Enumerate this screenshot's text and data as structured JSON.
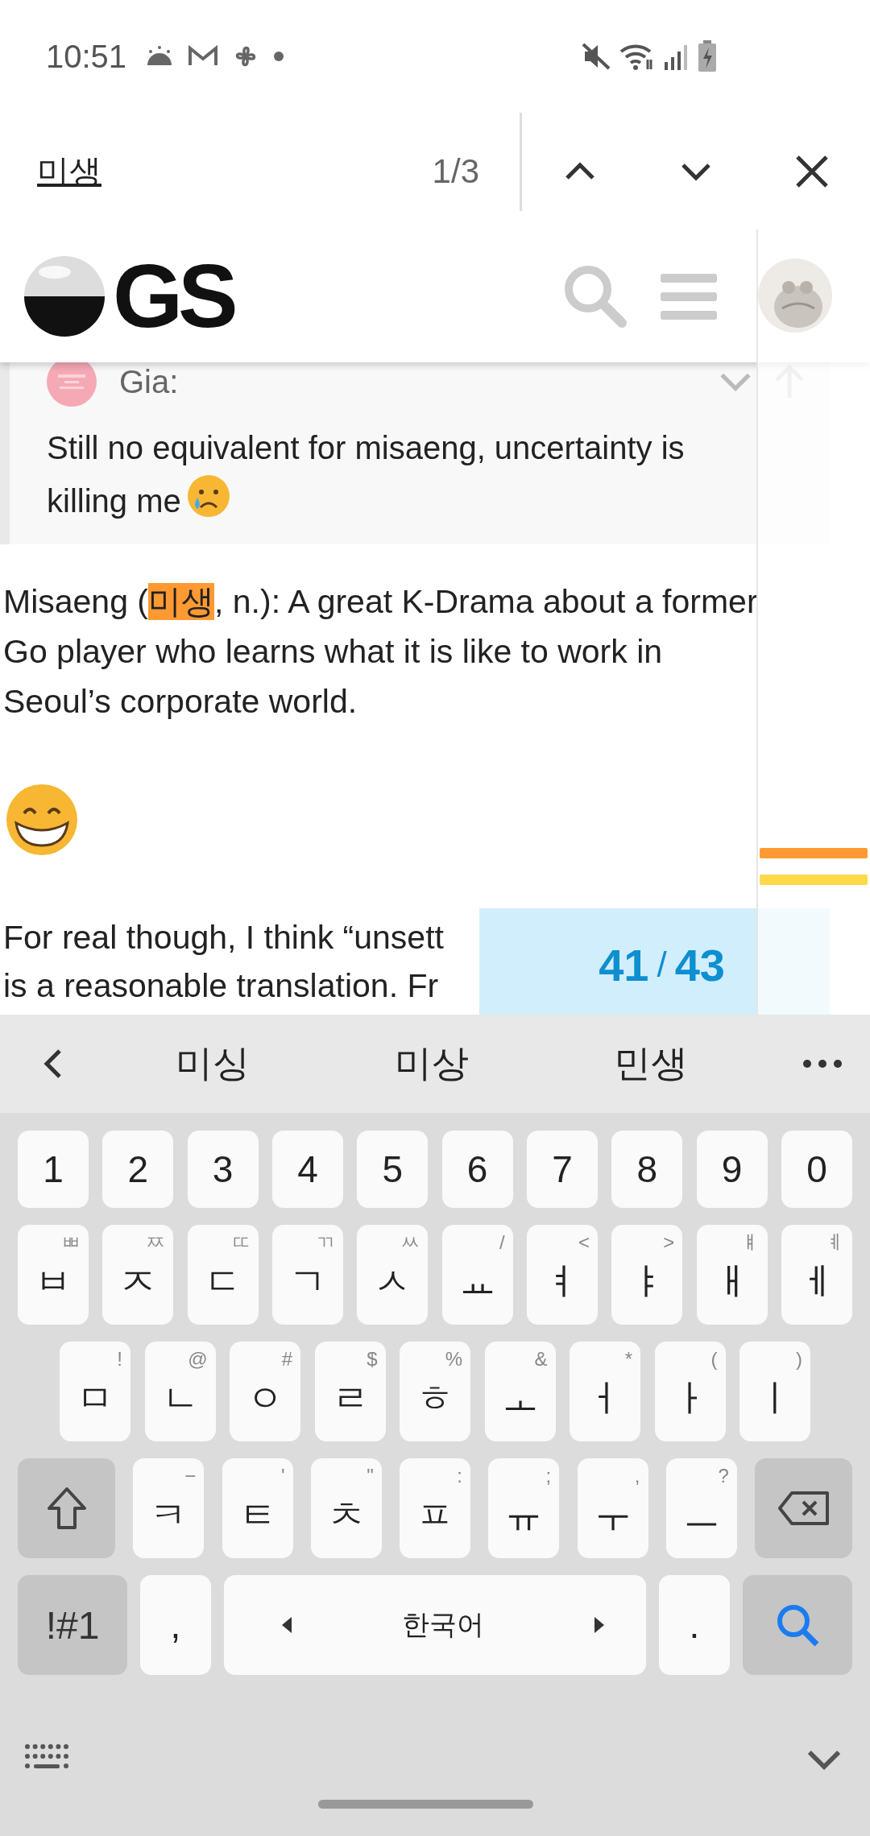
{
  "status_bar": {
    "time": "10:51"
  },
  "find_bar": {
    "query": "미생",
    "match_count": "1/3"
  },
  "site_header": {
    "logo_text": "GS"
  },
  "quote": {
    "author": "Gia:",
    "lines": [
      "Still no equivalent for misaeng, uncertainty is",
      "killing me"
    ]
  },
  "paragraphs": [
    {
      "lines": [
        [
          {
            "text": "Misaeng ("
          },
          {
            "text": "미생",
            "kind": "match"
          },
          {
            "text": ", n.): A great K-Drama about a former"
          }
        ],
        [
          {
            "text": "Go player who learns what it is like to work in"
          }
        ],
        [
          {
            "text": "Seoul’s corporate world."
          }
        ]
      ]
    },
    {
      "kind": "emoji"
    },
    {
      "lines": [
        [
          {
            "text": "For real though, I think “unsett"
          }
        ],
        [
          {
            "text": "is a reasonable translation. Fr"
          }
        ]
      ]
    }
  ],
  "timeline": {
    "marks": [
      {
        "color": "#ff9a33"
      },
      {
        "color": "#ffd94a"
      }
    ],
    "current": "41",
    "separator": "/",
    "total": "43"
  },
  "keyboard": {
    "suggestions": [
      "미싱",
      "미상",
      "민생"
    ],
    "rows": [
      [
        {
          "kind": "char",
          "label": "1"
        },
        {
          "kind": "char",
          "label": "2"
        },
        {
          "kind": "char",
          "label": "3"
        },
        {
          "kind": "char",
          "label": "4"
        },
        {
          "kind": "char",
          "label": "5"
        },
        {
          "kind": "char",
          "label": "6"
        },
        {
          "kind": "char",
          "label": "7"
        },
        {
          "kind": "char",
          "label": "8"
        },
        {
          "kind": "char",
          "label": "9"
        },
        {
          "kind": "char",
          "label": "0"
        }
      ],
      [
        {
          "kind": "char",
          "label": "ㅂ",
          "hint": "ㅃ"
        },
        {
          "kind": "char",
          "label": "ㅈ",
          "hint": "ㅉ"
        },
        {
          "kind": "char",
          "label": "ㄷ",
          "hint": "ㄸ"
        },
        {
          "kind": "char",
          "label": "ㄱ",
          "hint": "ㄲ"
        },
        {
          "kind": "char",
          "label": "ㅅ",
          "hint": "ㅆ"
        },
        {
          "kind": "char",
          "label": "ㅛ",
          "hint": "/"
        },
        {
          "kind": "char",
          "label": "ㅕ",
          "hint": "<"
        },
        {
          "kind": "char",
          "label": "ㅑ",
          "hint": ">"
        },
        {
          "kind": "char",
          "label": "ㅐ",
          "hint": "ㅒ"
        },
        {
          "kind": "char",
          "label": "ㅔ",
          "hint": "ㅖ"
        }
      ],
      [
        {
          "kind": "char",
          "label": "ㅁ",
          "hint": "!"
        },
        {
          "kind": "char",
          "label": "ㄴ",
          "hint": "@"
        },
        {
          "kind": "char",
          "label": "ㅇ",
          "hint": "#"
        },
        {
          "kind": "char",
          "label": "ㄹ",
          "hint": "$"
        },
        {
          "kind": "char",
          "label": "ㅎ",
          "hint": "%"
        },
        {
          "kind": "char",
          "label": "ㅗ",
          "hint": "&"
        },
        {
          "kind": "char",
          "label": "ㅓ",
          "hint": "*"
        },
        {
          "kind": "char",
          "label": "ㅏ",
          "hint": "("
        },
        {
          "kind": "char",
          "label": "ㅣ",
          "hint": ")"
        }
      ],
      [
        {
          "kind": "shift"
        },
        {
          "kind": "char",
          "label": "ㅋ",
          "hint": "−"
        },
        {
          "kind": "char",
          "label": "ㅌ",
          "hint": "'"
        },
        {
          "kind": "char",
          "label": "ㅊ",
          "hint": "\""
        },
        {
          "kind": "char",
          "label": "ㅍ",
          "hint": ":"
        },
        {
          "kind": "char",
          "label": "ㅠ",
          "hint": ";"
        },
        {
          "kind": "char",
          "label": "ㅜ",
          "hint": ","
        },
        {
          "kind": "char",
          "label": "ㅡ",
          "hint": "?"
        },
        {
          "kind": "backspace"
        }
      ],
      [
        {
          "kind": "symbols",
          "label": "!#1"
        },
        {
          "kind": "char",
          "label": ","
        },
        {
          "kind": "space",
          "label": "한국어"
        },
        {
          "kind": "char",
          "label": "."
        },
        {
          "kind": "search"
        }
      ]
    ]
  }
}
